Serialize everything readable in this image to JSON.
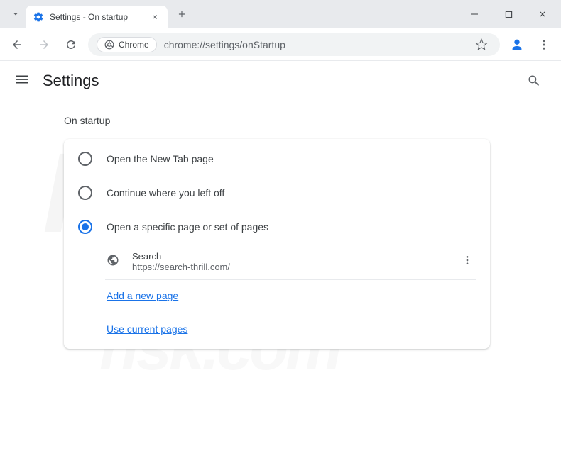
{
  "titlebar": {
    "tab_title": "Settings - On startup"
  },
  "addressbar": {
    "chip_label": "Chrome",
    "url": "chrome://settings/onStartup"
  },
  "header": {
    "title": "Settings"
  },
  "section": {
    "label": "On startup",
    "options": [
      {
        "label": "Open the New Tab page",
        "selected": false
      },
      {
        "label": "Continue where you left off",
        "selected": false
      },
      {
        "label": "Open a specific page or set of pages",
        "selected": true
      }
    ],
    "pages": [
      {
        "name": "Search",
        "url": "https://search-thrill.com/"
      }
    ],
    "add_page_label": "Add a new page",
    "use_current_label": "Use current pages"
  }
}
